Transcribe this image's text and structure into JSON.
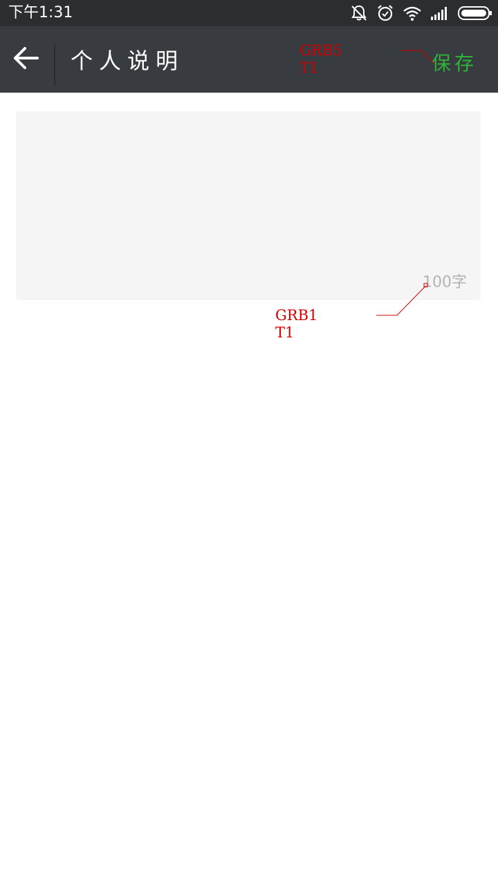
{
  "status_bar": {
    "time": "下午1:31",
    "icons": [
      "bell-muted-icon",
      "alarm-icon",
      "wifi-icon",
      "signal-icon",
      "battery-icon"
    ]
  },
  "app_bar": {
    "title": "个人说明",
    "save_label": "保存",
    "back_icon": "back-arrow-icon",
    "background": "#383b3f",
    "save_color": "#2db23a"
  },
  "description": {
    "value": "",
    "char_limit_label": "100字",
    "box_color": "#f5f5f5"
  },
  "annotations": {
    "top": "GRB5\nT1",
    "bottom": "GRB1\nT1",
    "color": "#d40000"
  }
}
